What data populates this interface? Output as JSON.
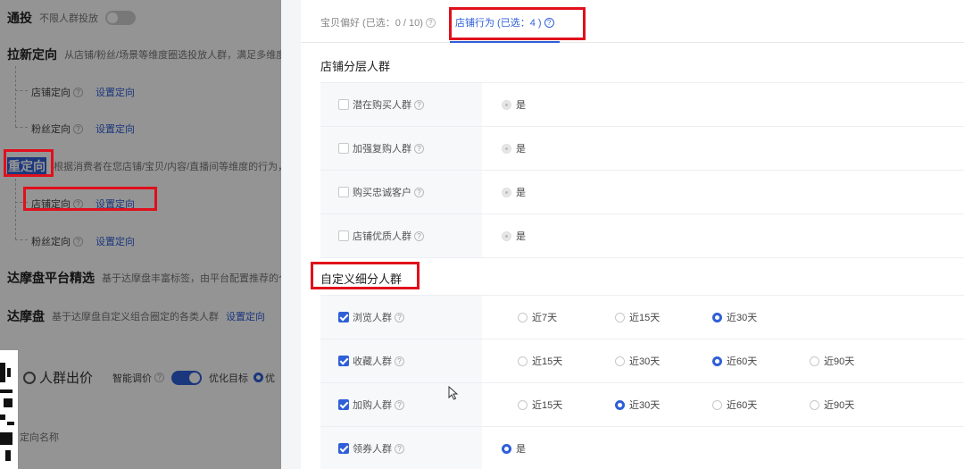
{
  "left": {
    "row1": {
      "title": "通投",
      "desc": "不限人群投放"
    },
    "row2": {
      "title": "拉新定向",
      "desc": "从店铺/粉丝/场景等维度圈选投放人群，满足多维度"
    },
    "row2_subs": [
      {
        "label": "店铺定向",
        "link": "设置定向"
      },
      {
        "label": "粉丝定向",
        "link": "设置定向"
      }
    ],
    "row3": {
      "title": "重定向",
      "desc": "根据消费者在您店铺/宝贝/内容/直播间等维度的行为，"
    },
    "row3_subs": [
      {
        "label": "店铺定向",
        "link": "设置定向"
      },
      {
        "label": "粉丝定向",
        "link": "设置定向"
      }
    ],
    "row4": {
      "title": "达摩盘平台精选",
      "desc": "基于达摩盘丰富标签，由平台配置推荐的个"
    },
    "row5": {
      "title": "达摩盘",
      "desc": "基于达摩盘自定义组合圈定的各类人群",
      "link": "设置定向"
    },
    "bid": {
      "title": "人群出价",
      "smart": "智能调价",
      "goal": "优化目标",
      "goal_short": "优"
    },
    "col_header": "定向名称"
  },
  "tabs": [
    {
      "label": "宝贝偏好 (已选：0 / 10)"
    },
    {
      "label": "店铺行为 (已选：4 )"
    }
  ],
  "section1": {
    "title": "店铺分层人群",
    "rows": [
      {
        "label": "潜在购买人群",
        "option": "是"
      },
      {
        "label": "加强复购人群",
        "option": "是"
      },
      {
        "label": "购买忠诚客户",
        "option": "是"
      },
      {
        "label": "店铺优质人群",
        "option": "是"
      }
    ]
  },
  "section2": {
    "title": "自定义细分人群",
    "rows": [
      {
        "label": "浏览人群",
        "options": [
          "近7天",
          "近15天",
          "近30天"
        ],
        "selected": 2
      },
      {
        "label": "收藏人群",
        "options": [
          "近15天",
          "近30天",
          "近60天",
          "近90天"
        ],
        "selected": 2
      },
      {
        "label": "加购人群",
        "options": [
          "近15天",
          "近30天",
          "近60天",
          "近90天"
        ],
        "selected": 1
      },
      {
        "label": "领券人群",
        "options": [
          "是"
        ],
        "selected": 0
      }
    ]
  },
  "colors": {
    "accent": "#2f5fd8",
    "highlight_box": "#e0101c"
  }
}
